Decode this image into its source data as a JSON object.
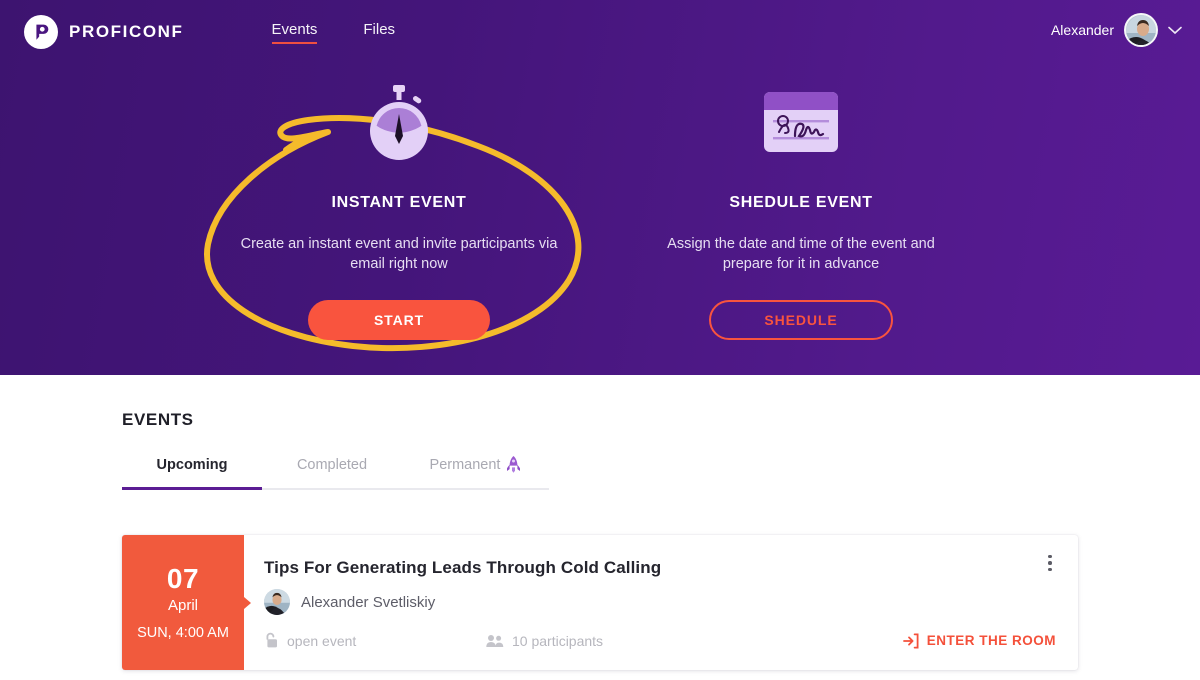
{
  "brand": {
    "name": "PROFICONF",
    "logo_icon": "proficonf-logo-icon"
  },
  "nav": {
    "links": [
      {
        "label": "Events",
        "active": true
      },
      {
        "label": "Files",
        "active": false
      }
    ]
  },
  "user": {
    "name": "Alexander",
    "avatar_icon": "user-avatar",
    "chevron_icon": "chevron-down-icon"
  },
  "hero": {
    "annotation_icon": "handdrawn-yellow-ellipse",
    "accent_color": "#f9543e",
    "annotation_color": "#f5bb2b",
    "background_color": "#4a1680",
    "cards": [
      {
        "icon": "stopwatch-icon",
        "title": "INSTANT EVENT",
        "description": "Create an instant event and invite participants via email right now",
        "button_label": "START",
        "button_style": "solid"
      },
      {
        "icon": "calendar-note-icon",
        "title": "SHEDULE EVENT",
        "description": "Assign the date and time of the event and prepare for it in advance",
        "button_label": "SHEDULE",
        "button_style": "outline"
      }
    ]
  },
  "events": {
    "section_title": "EVENTS",
    "active_tab_color": "#5b1d94",
    "tabs": [
      {
        "label": "Upcoming",
        "active": true,
        "icon": ""
      },
      {
        "label": "Completed",
        "active": false,
        "icon": ""
      },
      {
        "label": "Permanent",
        "active": false,
        "icon": "rocket-icon"
      }
    ],
    "list": [
      {
        "day": "07",
        "month": "April",
        "time": "SUN, 4:00 AM",
        "date_block_color": "#f15a3d",
        "title": "Tips For Generating Leads Through Cold Calling",
        "author": "Alexander Svetliskiy",
        "author_avatar_icon": "author-avatar",
        "access_icon": "open-lock-icon",
        "access_label": "open event",
        "participants_icon": "participants-icon",
        "participants_label": "10 participants",
        "enter_icon": "enter-arrow-icon",
        "enter_label": "ENTER THE ROOM",
        "menu_icon": "kebab-menu-icon"
      }
    ]
  }
}
